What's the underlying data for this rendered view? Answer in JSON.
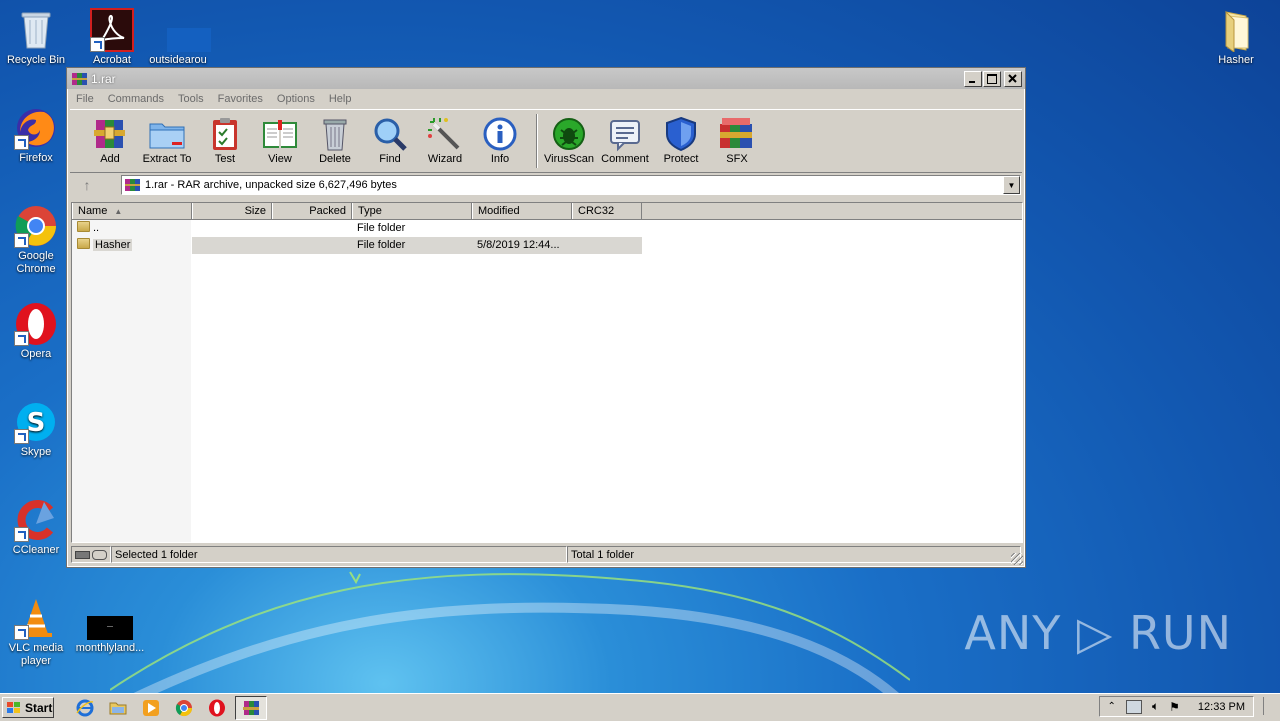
{
  "desktop": {
    "icons": [
      {
        "label": "Recycle Bin"
      },
      {
        "label": "Acrobat"
      },
      {
        "label": "outsidearou"
      },
      {
        "label": "Firefox"
      },
      {
        "label": "Google Chrome"
      },
      {
        "label": "Opera"
      },
      {
        "label": "Skype"
      },
      {
        "label": "CCleaner"
      },
      {
        "label": "VLC media player"
      },
      {
        "label": "monthlyland..."
      },
      {
        "label": "Hasher"
      }
    ],
    "watermark": "ANY ▷ RUN"
  },
  "window": {
    "title": "1.rar",
    "menu": [
      "File",
      "Commands",
      "Tools",
      "Favorites",
      "Options",
      "Help"
    ],
    "toolbar": [
      {
        "label": "Add",
        "icon": "winrar-add-icon"
      },
      {
        "label": "Extract To",
        "icon": "folder-extract-icon"
      },
      {
        "label": "Test",
        "icon": "clipboard-check-icon"
      },
      {
        "label": "View",
        "icon": "book-icon"
      },
      {
        "label": "Delete",
        "icon": "trash-icon"
      },
      {
        "label": "Find",
        "icon": "magnifier-icon"
      },
      {
        "label": "Wizard",
        "icon": "magic-wand-icon"
      },
      {
        "label": "Info",
        "icon": "info-icon"
      },
      {
        "label": "VirusScan",
        "icon": "bug-icon"
      },
      {
        "label": "Comment",
        "icon": "comment-icon"
      },
      {
        "label": "Protect",
        "icon": "shield-icon"
      },
      {
        "label": "SFX",
        "icon": "sfx-boxes-icon"
      }
    ],
    "address": "1.rar - RAR archive, unpacked size 6,627,496 bytes",
    "columns": [
      "Name",
      "Size",
      "Packed",
      "Type",
      "Modified",
      "CRC32"
    ],
    "rows": [
      {
        "name": "..",
        "size": "",
        "packed": "",
        "type": "File folder",
        "modified": "",
        "crc": ""
      },
      {
        "name": "Hasher",
        "size": "",
        "packed": "",
        "type": "File folder",
        "modified": "5/8/2019 12:44...",
        "crc": "",
        "selected": true
      }
    ],
    "status": {
      "left": "Selected 1 folder",
      "right": "Total 1 folder"
    }
  },
  "taskbar": {
    "start": "Start",
    "clock": "12:33 PM"
  }
}
